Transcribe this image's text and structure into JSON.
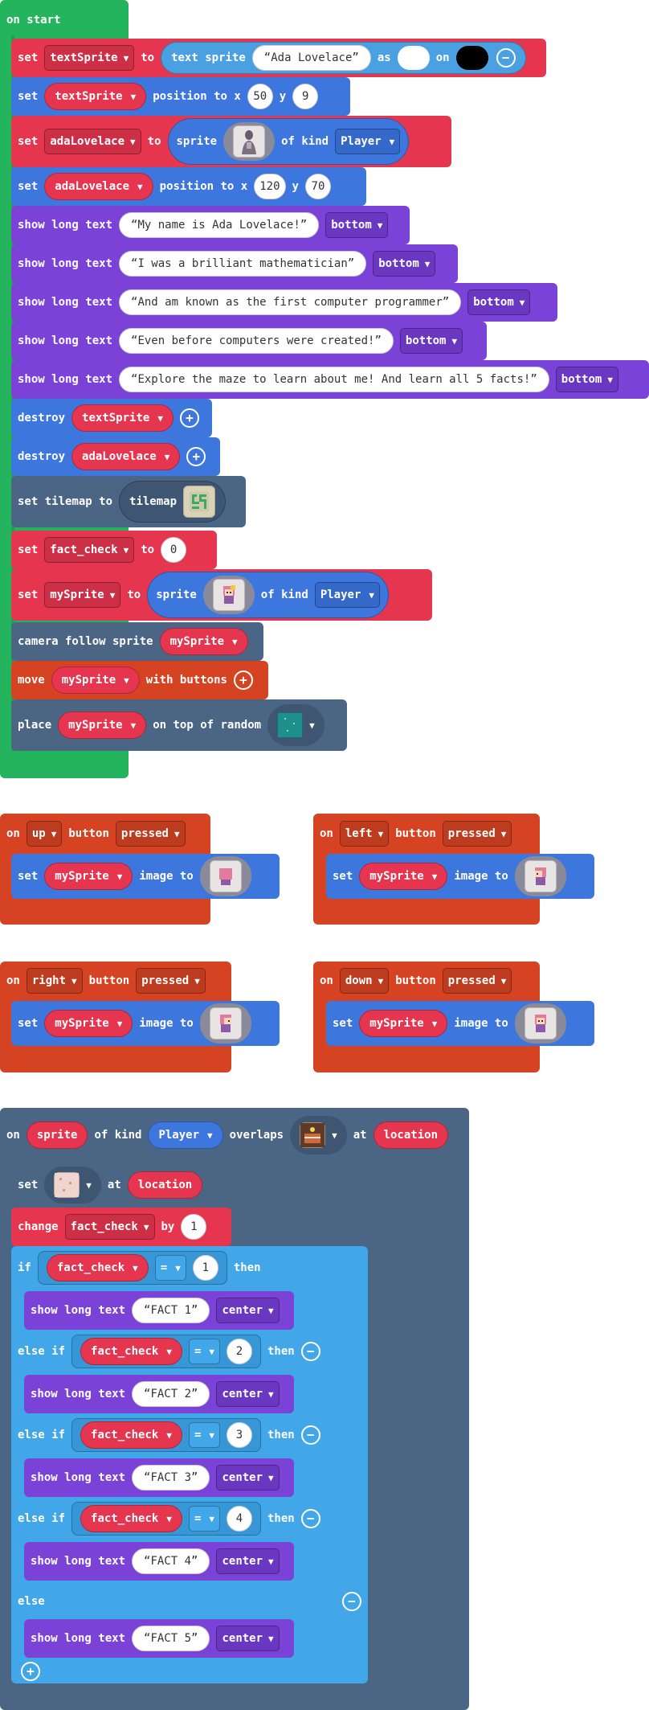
{
  "on_start": {
    "hat_label": "on start",
    "set1": {
      "label": "set",
      "var": "textSprite",
      "to": "to",
      "func": "text sprite",
      "text": "Ada Lovelace",
      "as": "as",
      "on": "on",
      "fg_color": "#ffffff",
      "bg_color": "#000000"
    },
    "pos1": {
      "label": "set",
      "var": "textSprite",
      "mid": "position to x",
      "x": "50",
      "y_label": "y",
      "y": "9"
    },
    "set2": {
      "label": "set",
      "var": "adaLovelace",
      "to": "to",
      "func": "sprite",
      "of_kind": "of kind",
      "kind": "Player"
    },
    "pos2": {
      "label": "set",
      "var": "adaLovelace",
      "mid": "position to x",
      "x": "120",
      "y_label": "y",
      "y": "70"
    },
    "texts": [
      {
        "label": "show long text",
        "text": "My name is Ada Lovelace!",
        "where": "bottom"
      },
      {
        "label": "show long text",
        "text": "I was a brilliant mathematician",
        "where": "bottom"
      },
      {
        "label": "show long text",
        "text": "And am known as the first computer programmer",
        "where": "bottom"
      },
      {
        "label": "show long text",
        "text": "Even before computers were created!",
        "where": "bottom"
      },
      {
        "label": "show long text",
        "text": "Explore the maze to learn about me! And learn all 5 facts!",
        "where": "bottom"
      }
    ],
    "destroy1": {
      "label": "destroy",
      "var": "textSprite"
    },
    "destroy2": {
      "label": "destroy",
      "var": "adaLovelace"
    },
    "tilemap": {
      "label": "set tilemap to",
      "func": "tilemap"
    },
    "fact": {
      "label": "set",
      "var": "fact_check",
      "to": "to",
      "value": "0"
    },
    "set3": {
      "label": "set",
      "var": "mySprite",
      "to": "to",
      "func": "sprite",
      "of_kind": "of kind",
      "kind": "Player"
    },
    "camera": {
      "label": "camera follow sprite",
      "var": "mySprite"
    },
    "move": {
      "label": "move",
      "var": "mySprite",
      "with": "with buttons"
    },
    "place": {
      "label": "place",
      "var": "mySprite",
      "on": "on top of random"
    }
  },
  "buttons": [
    {
      "on": "on",
      "btn": "up",
      "button": "button",
      "event": "pressed",
      "set": "set",
      "var": "mySprite",
      "image_to": "image to"
    },
    {
      "on": "on",
      "btn": "left",
      "button": "button",
      "event": "pressed",
      "set": "set",
      "var": "mySprite",
      "image_to": "image to"
    },
    {
      "on": "on",
      "btn": "right",
      "button": "button",
      "event": "pressed",
      "set": "set",
      "var": "mySprite",
      "image_to": "image to"
    },
    {
      "on": "on",
      "btn": "down",
      "button": "button",
      "event": "pressed",
      "set": "set",
      "var": "mySprite",
      "image_to": "image to"
    }
  ],
  "overlap": {
    "on": "on",
    "sprite": "sprite",
    "of_kind": "of kind",
    "kind": "Player",
    "overlaps": "overlaps",
    "at": "at",
    "location": "location",
    "set": {
      "label": "set",
      "at": "at",
      "location": "location"
    },
    "change": {
      "label": "change",
      "var": "fact_check",
      "by": "by",
      "value": "1"
    },
    "if": "if",
    "else_if": "else if",
    "then": "then",
    "else": "else",
    "op": "=",
    "cond_var": "fact_check",
    "branches": [
      {
        "value": "1",
        "label": "show long text",
        "text": "FACT 1",
        "where": "center"
      },
      {
        "value": "2",
        "label": "show long text",
        "text": "FACT 2",
        "where": "center"
      },
      {
        "value": "3",
        "label": "show long text",
        "text": "FACT 3",
        "where": "center"
      },
      {
        "value": "4",
        "label": "show long text",
        "text": "FACT 4",
        "where": "center"
      }
    ],
    "else_branch": {
      "label": "show long text",
      "text": "FACT 5",
      "where": "center"
    }
  }
}
